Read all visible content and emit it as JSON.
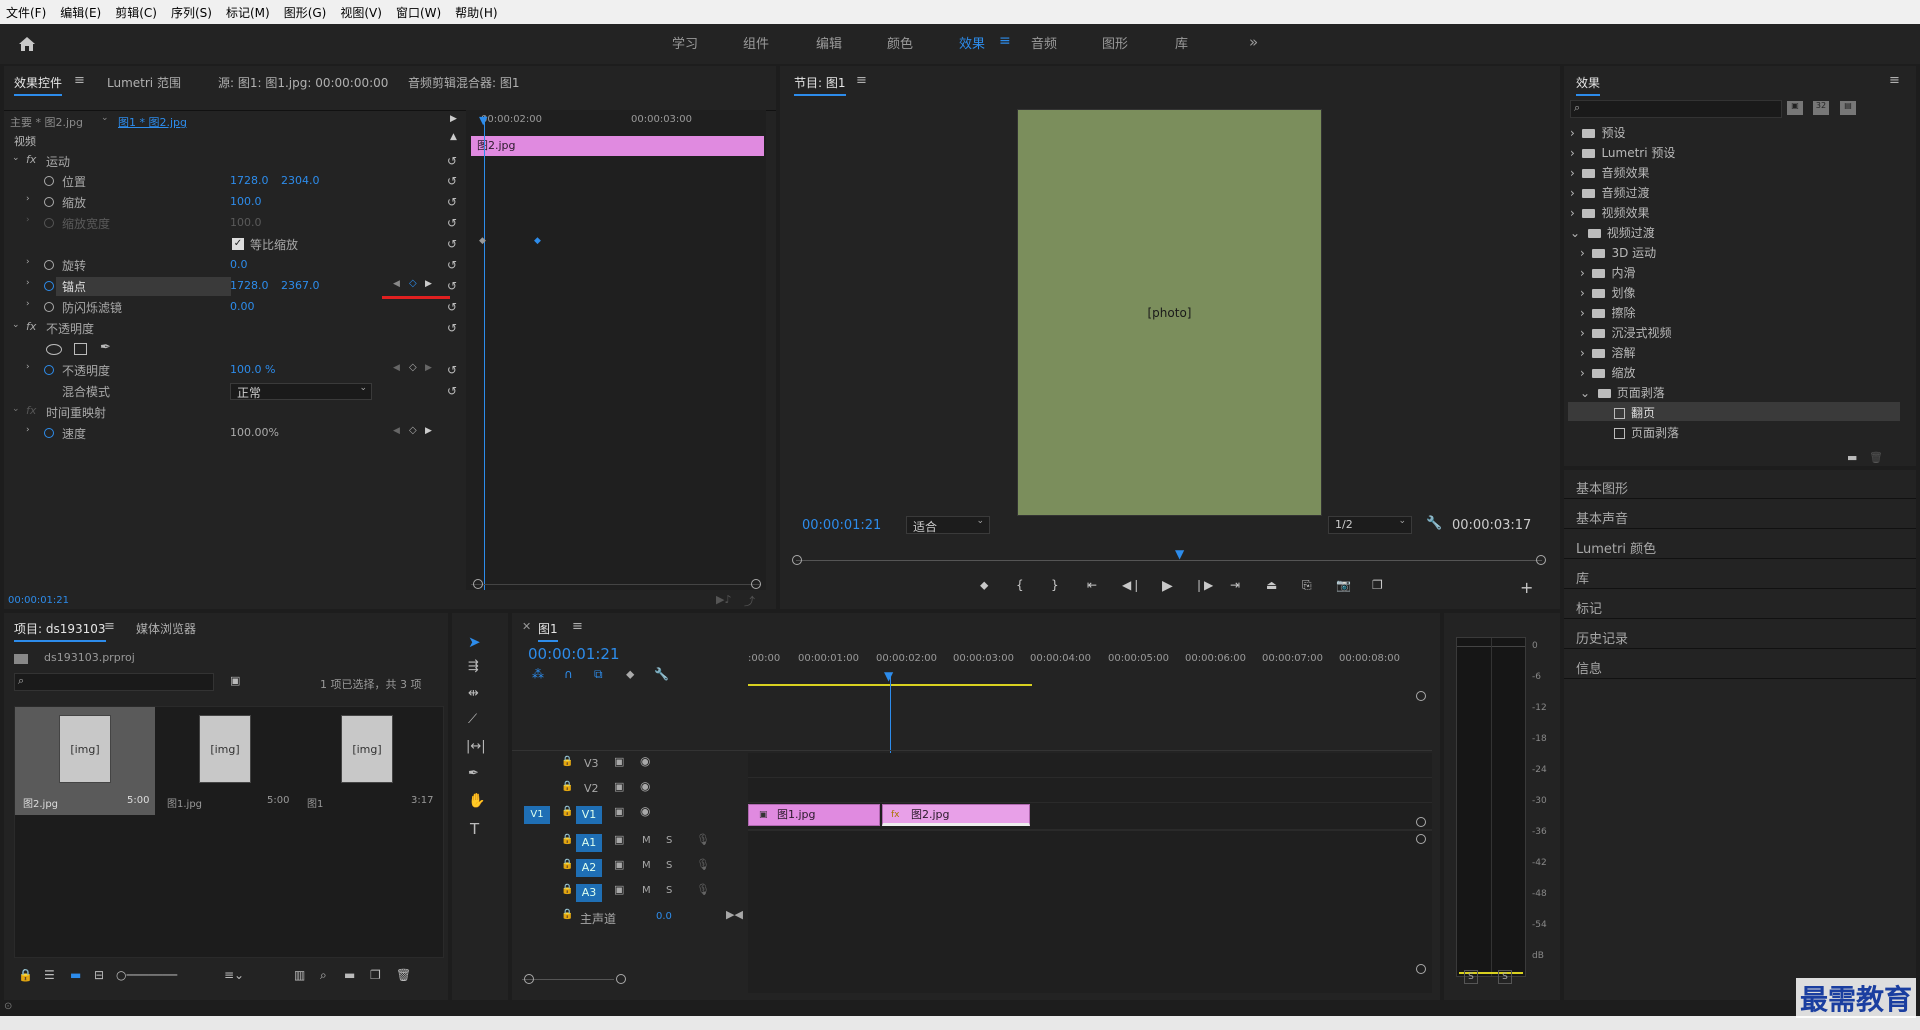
{
  "menu": [
    "文件(F)",
    "编辑(E)",
    "剪辑(C)",
    "序列(S)",
    "标记(M)",
    "图形(G)",
    "视图(V)",
    "窗口(W)",
    "帮助(H)"
  ],
  "workspaces": [
    {
      "label": "学习"
    },
    {
      "label": "组件"
    },
    {
      "label": "编辑"
    },
    {
      "label": "颜色"
    },
    {
      "label": "效果",
      "active": true
    },
    {
      "label": "音频"
    },
    {
      "label": "图形"
    },
    {
      "label": "库"
    }
  ],
  "effect_controls": {
    "tabs": [
      "效果控件",
      "Lumetri 范围",
      "源: 图1: 图1.jpg: 00:00:00:00",
      "音频剪辑混合器: 图1"
    ],
    "master_clip": "主要 * 图2.jpg",
    "sequence_clip": "图1 * 图2.jpg",
    "section_video": "视频",
    "timeline_times": [
      "00:00:02:00",
      "00:00:03:00"
    ],
    "clip_name": "图2.jpg",
    "rows": [
      {
        "label": "运动",
        "kind": "fx"
      },
      {
        "label": "位置",
        "v1": "1728.0",
        "v2": "2304.0"
      },
      {
        "label": "缩放",
        "v1": "100.0"
      },
      {
        "label": "缩放宽度",
        "v1": "100.0",
        "disabled": true
      },
      {
        "label": "等比缩放",
        "kind": "checkbox"
      },
      {
        "label": "旋转",
        "v1": "0.0"
      },
      {
        "label": "锚点",
        "v1": "1728.0",
        "v2": "2367.0",
        "highlight": true
      },
      {
        "label": "防闪烁滤镜",
        "v1": "0.00"
      },
      {
        "label": "不透明度",
        "kind": "fx"
      },
      {
        "label": "不透明度",
        "v1": "100.0 %"
      },
      {
        "label": "混合模式",
        "v1": "正常",
        "kind": "select"
      },
      {
        "label": "时间重映射",
        "kind": "fx",
        "disabled": true
      },
      {
        "label": "速度",
        "v1": "100.00%"
      }
    ],
    "current_time": "00:00:01:21"
  },
  "program_monitor": {
    "title": "节目: 图1",
    "timecode": "00:00:01:21",
    "fit": "适合",
    "resolution": "1/2",
    "duration": "00:00:03:17"
  },
  "effects_panel": {
    "title": "效果",
    "items": [
      {
        "label": "预设",
        "level": 0
      },
      {
        "label": "Lumetri 预设",
        "level": 0
      },
      {
        "label": "音频效果",
        "level": 0
      },
      {
        "label": "音频过渡",
        "level": 0
      },
      {
        "label": "视频效果",
        "level": 0
      },
      {
        "label": "视频过渡",
        "level": 0,
        "open": true
      },
      {
        "label": "3D 运动",
        "level": 1
      },
      {
        "label": "内滑",
        "level": 1
      },
      {
        "label": "划像",
        "level": 1
      },
      {
        "label": "擦除",
        "level": 1
      },
      {
        "label": "沉浸式视频",
        "level": 1
      },
      {
        "label": "溶解",
        "level": 1
      },
      {
        "label": "缩放",
        "level": 1
      },
      {
        "label": "页面剥落",
        "level": 1,
        "open": true
      },
      {
        "label": "翻页",
        "level": 2,
        "selected": true
      },
      {
        "label": "页面剥落",
        "level": 2
      }
    ],
    "collapsed_panels": [
      "基本图形",
      "基本声音",
      "Lumetri 颜色",
      "库",
      "标记",
      "历史记录",
      "信息"
    ]
  },
  "project": {
    "tabs": [
      "项目: ds193103",
      "媒体浏览器"
    ],
    "file": "ds193103.prproj",
    "selection": "1 项已选择，共 3 项",
    "items": [
      {
        "name": "图2.jpg",
        "dur": "5:00",
        "selected": true
      },
      {
        "name": "图1.jpg",
        "dur": "5:00"
      },
      {
        "name": "图1",
        "dur": "3:17"
      }
    ]
  },
  "timeline": {
    "tab": "图1",
    "timecode": "00:00:01:21",
    "ruler": [
      ":00:00",
      "00:00:01:00",
      "00:00:02:00",
      "00:00:03:00",
      "00:00:04:00",
      "00:00:05:00",
      "00:00:06:00",
      "00:00:07:00",
      "00:00:08:00"
    ],
    "video_tracks": [
      "V3",
      "V2",
      "V1"
    ],
    "audio_tracks": [
      "A1",
      "A2",
      "A3"
    ],
    "source_patch": "V1",
    "master": "主声道",
    "master_value": "0.0",
    "m_label": "M",
    "s_label": "S",
    "clips": [
      {
        "name": "图1.jpg"
      },
      {
        "name": "图2.jpg",
        "fx": "fx"
      }
    ]
  },
  "audio_meter": {
    "scale": [
      "0",
      "-6",
      "-12",
      "-18",
      "-24",
      "-30",
      "-36",
      "-42",
      "-48",
      "-54",
      "dB"
    ],
    "buttons": [
      "S",
      "S"
    ]
  },
  "watermark": "最需教育",
  "colors": {
    "accent": "#2d8ceb",
    "clip": "#e08ae0",
    "red": "#e02020"
  }
}
